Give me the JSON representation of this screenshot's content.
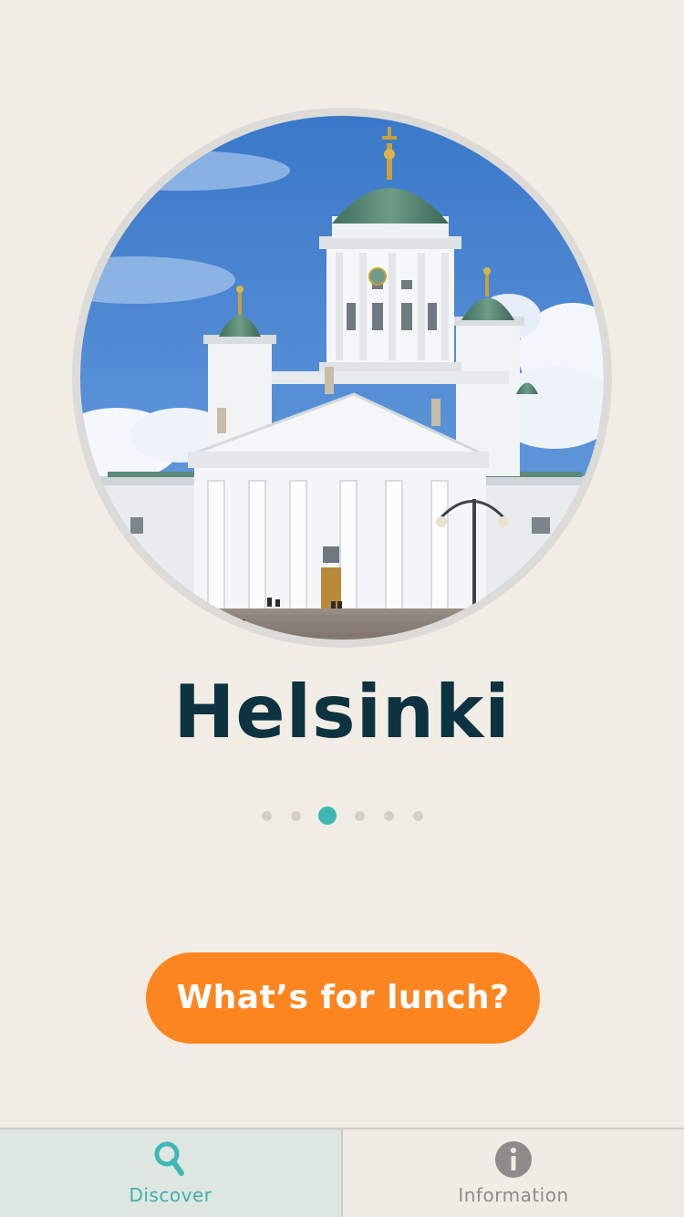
{
  "city": {
    "name": "Helsinki",
    "photo_icon": "helsinki-cathedral-photo"
  },
  "pager": {
    "total": 6,
    "active_index": 2
  },
  "cta": {
    "label": "What’s for lunch?"
  },
  "tabbar": {
    "items": [
      {
        "label": "Discover",
        "icon": "search-icon",
        "selected": true
      },
      {
        "label": "Information",
        "icon": "info-icon",
        "selected": false
      }
    ]
  },
  "colors": {
    "background": "#f2ede4",
    "title": "#0d3340",
    "accent": "#3fb8b4",
    "cta": "#fd8520",
    "dot_inactive": "#d3d0cc",
    "tab_selected_bg": "#dde6e0",
    "tab_inactive_text": "#8e8c8a"
  }
}
